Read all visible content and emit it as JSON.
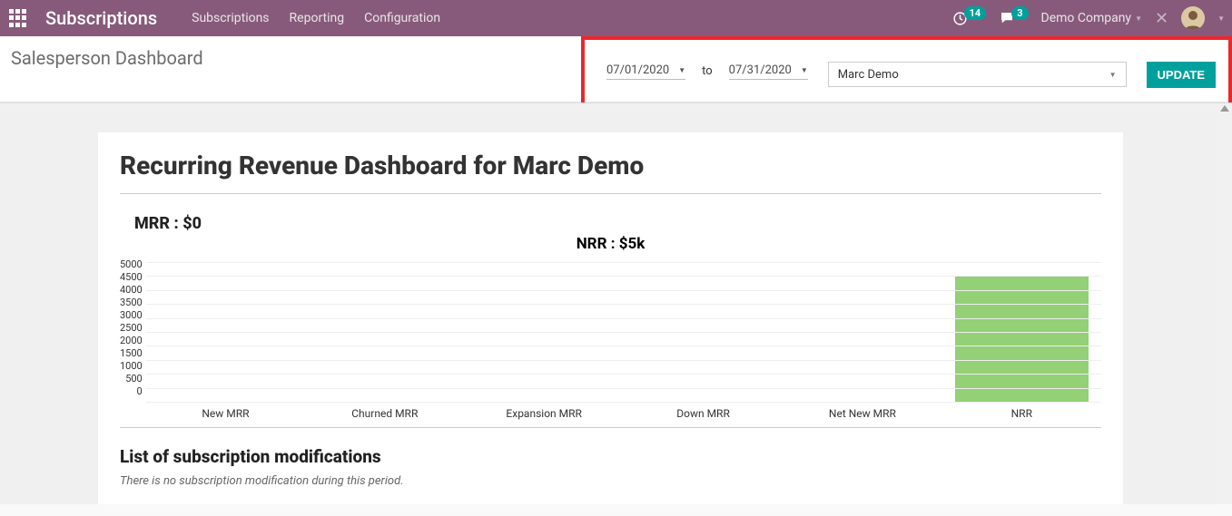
{
  "topbar": {
    "app_title": "Subscriptions",
    "nav": [
      "Subscriptions",
      "Reporting",
      "Configuration"
    ],
    "activity_badge": "14",
    "messages_badge": "3",
    "company": "Demo Company"
  },
  "subbar": {
    "title": "Salesperson Dashboard",
    "date_from": "07/01/2020",
    "to_label": "to",
    "date_to": "07/31/2020",
    "person": "Marc Demo",
    "update_label": "UPDATE"
  },
  "dashboard": {
    "title": "Recurring Revenue Dashboard for Marc Demo",
    "mrr_label": "MRR : $0",
    "nrr_label": "NRR : $5k",
    "mod_title": "List of subscription modifications",
    "mod_empty": "There is no subscription modification during this period."
  },
  "chart_data": {
    "type": "bar",
    "categories": [
      "New MRR",
      "Churned MRR",
      "Expansion MRR",
      "Down MRR",
      "Net New MRR",
      "NRR"
    ],
    "values": [
      0,
      0,
      0,
      0,
      0,
      4500
    ],
    "y_ticks": [
      5000,
      4500,
      4000,
      3500,
      3000,
      2500,
      2000,
      1500,
      1000,
      500,
      0
    ],
    "ylim": [
      0,
      5000
    ],
    "title": "NRR : $5k"
  }
}
